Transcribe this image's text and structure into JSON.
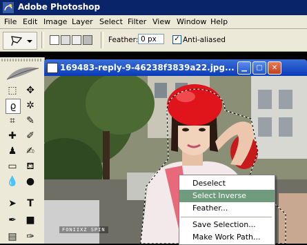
{
  "app": {
    "title": "Adobe Photoshop"
  },
  "menu": [
    "File",
    "Edit",
    "Image",
    "Layer",
    "Select",
    "Filter",
    "View",
    "Window",
    "Help"
  ],
  "options": {
    "feather_label": "Feather:",
    "feather_value": "0 px",
    "antialiased_label": "Anti-aliased",
    "antialiased_checked": "✓"
  },
  "document": {
    "title": "169483-reply-9-46238f3839a22.jpg...",
    "watermark": "FONIIXZ SPIN"
  },
  "context_menu": {
    "items": [
      "Deselect",
      "Select Inverse",
      "Feather...",
      "Save Selection...",
      "Make Work Path..."
    ],
    "highlighted": "Select Inverse"
  },
  "colors": {
    "titlebar": "#0a246a",
    "chrome": "#ece9d8",
    "hat": "#e0141b",
    "highlight": "#6f9c7d"
  }
}
